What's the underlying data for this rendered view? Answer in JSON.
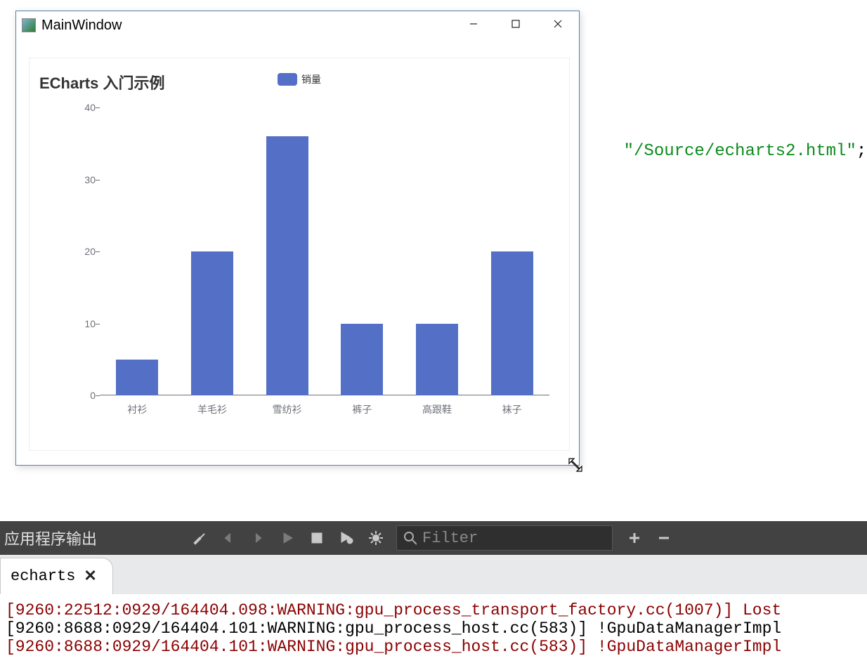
{
  "window": {
    "title": "MainWindow",
    "icon_name": "app-icon"
  },
  "code_fragment": {
    "prefix": " ",
    "string": "\"/Source/echarts2.html\"",
    "suffix": ";"
  },
  "chart_data": {
    "type": "bar",
    "title": "ECharts 入门示例",
    "legend": "销量",
    "categories": [
      "衬衫",
      "羊毛衫",
      "雪纺衫",
      "裤子",
      "高跟鞋",
      "袜子"
    ],
    "values": [
      5,
      20,
      36,
      10,
      10,
      20
    ],
    "y_ticks": [
      0,
      10,
      20,
      30,
      40
    ],
    "ylim": [
      0,
      40
    ],
    "xlabel": "",
    "ylabel": "",
    "bar_color": "#5470c6"
  },
  "output_panel": {
    "title": "应用程序输出",
    "filter_placeholder": "Filter",
    "tab_label": "echarts",
    "log_lines": [
      {
        "cls": "log-warn",
        "text": "[9260:22512:0929/164404.098:WARNING:gpu_process_transport_factory.cc(1007)] Lost"
      },
      {
        "cls": "log-info",
        "text": "[9260:8688:0929/164404.101:WARNING:gpu_process_host.cc(583)] !GpuDataManagerImpl"
      },
      {
        "cls": "log-warn",
        "text": "[9260:8688:0929/164404.101:WARNING:gpu_process_host.cc(583)] !GpuDataManagerImpl"
      }
    ]
  }
}
